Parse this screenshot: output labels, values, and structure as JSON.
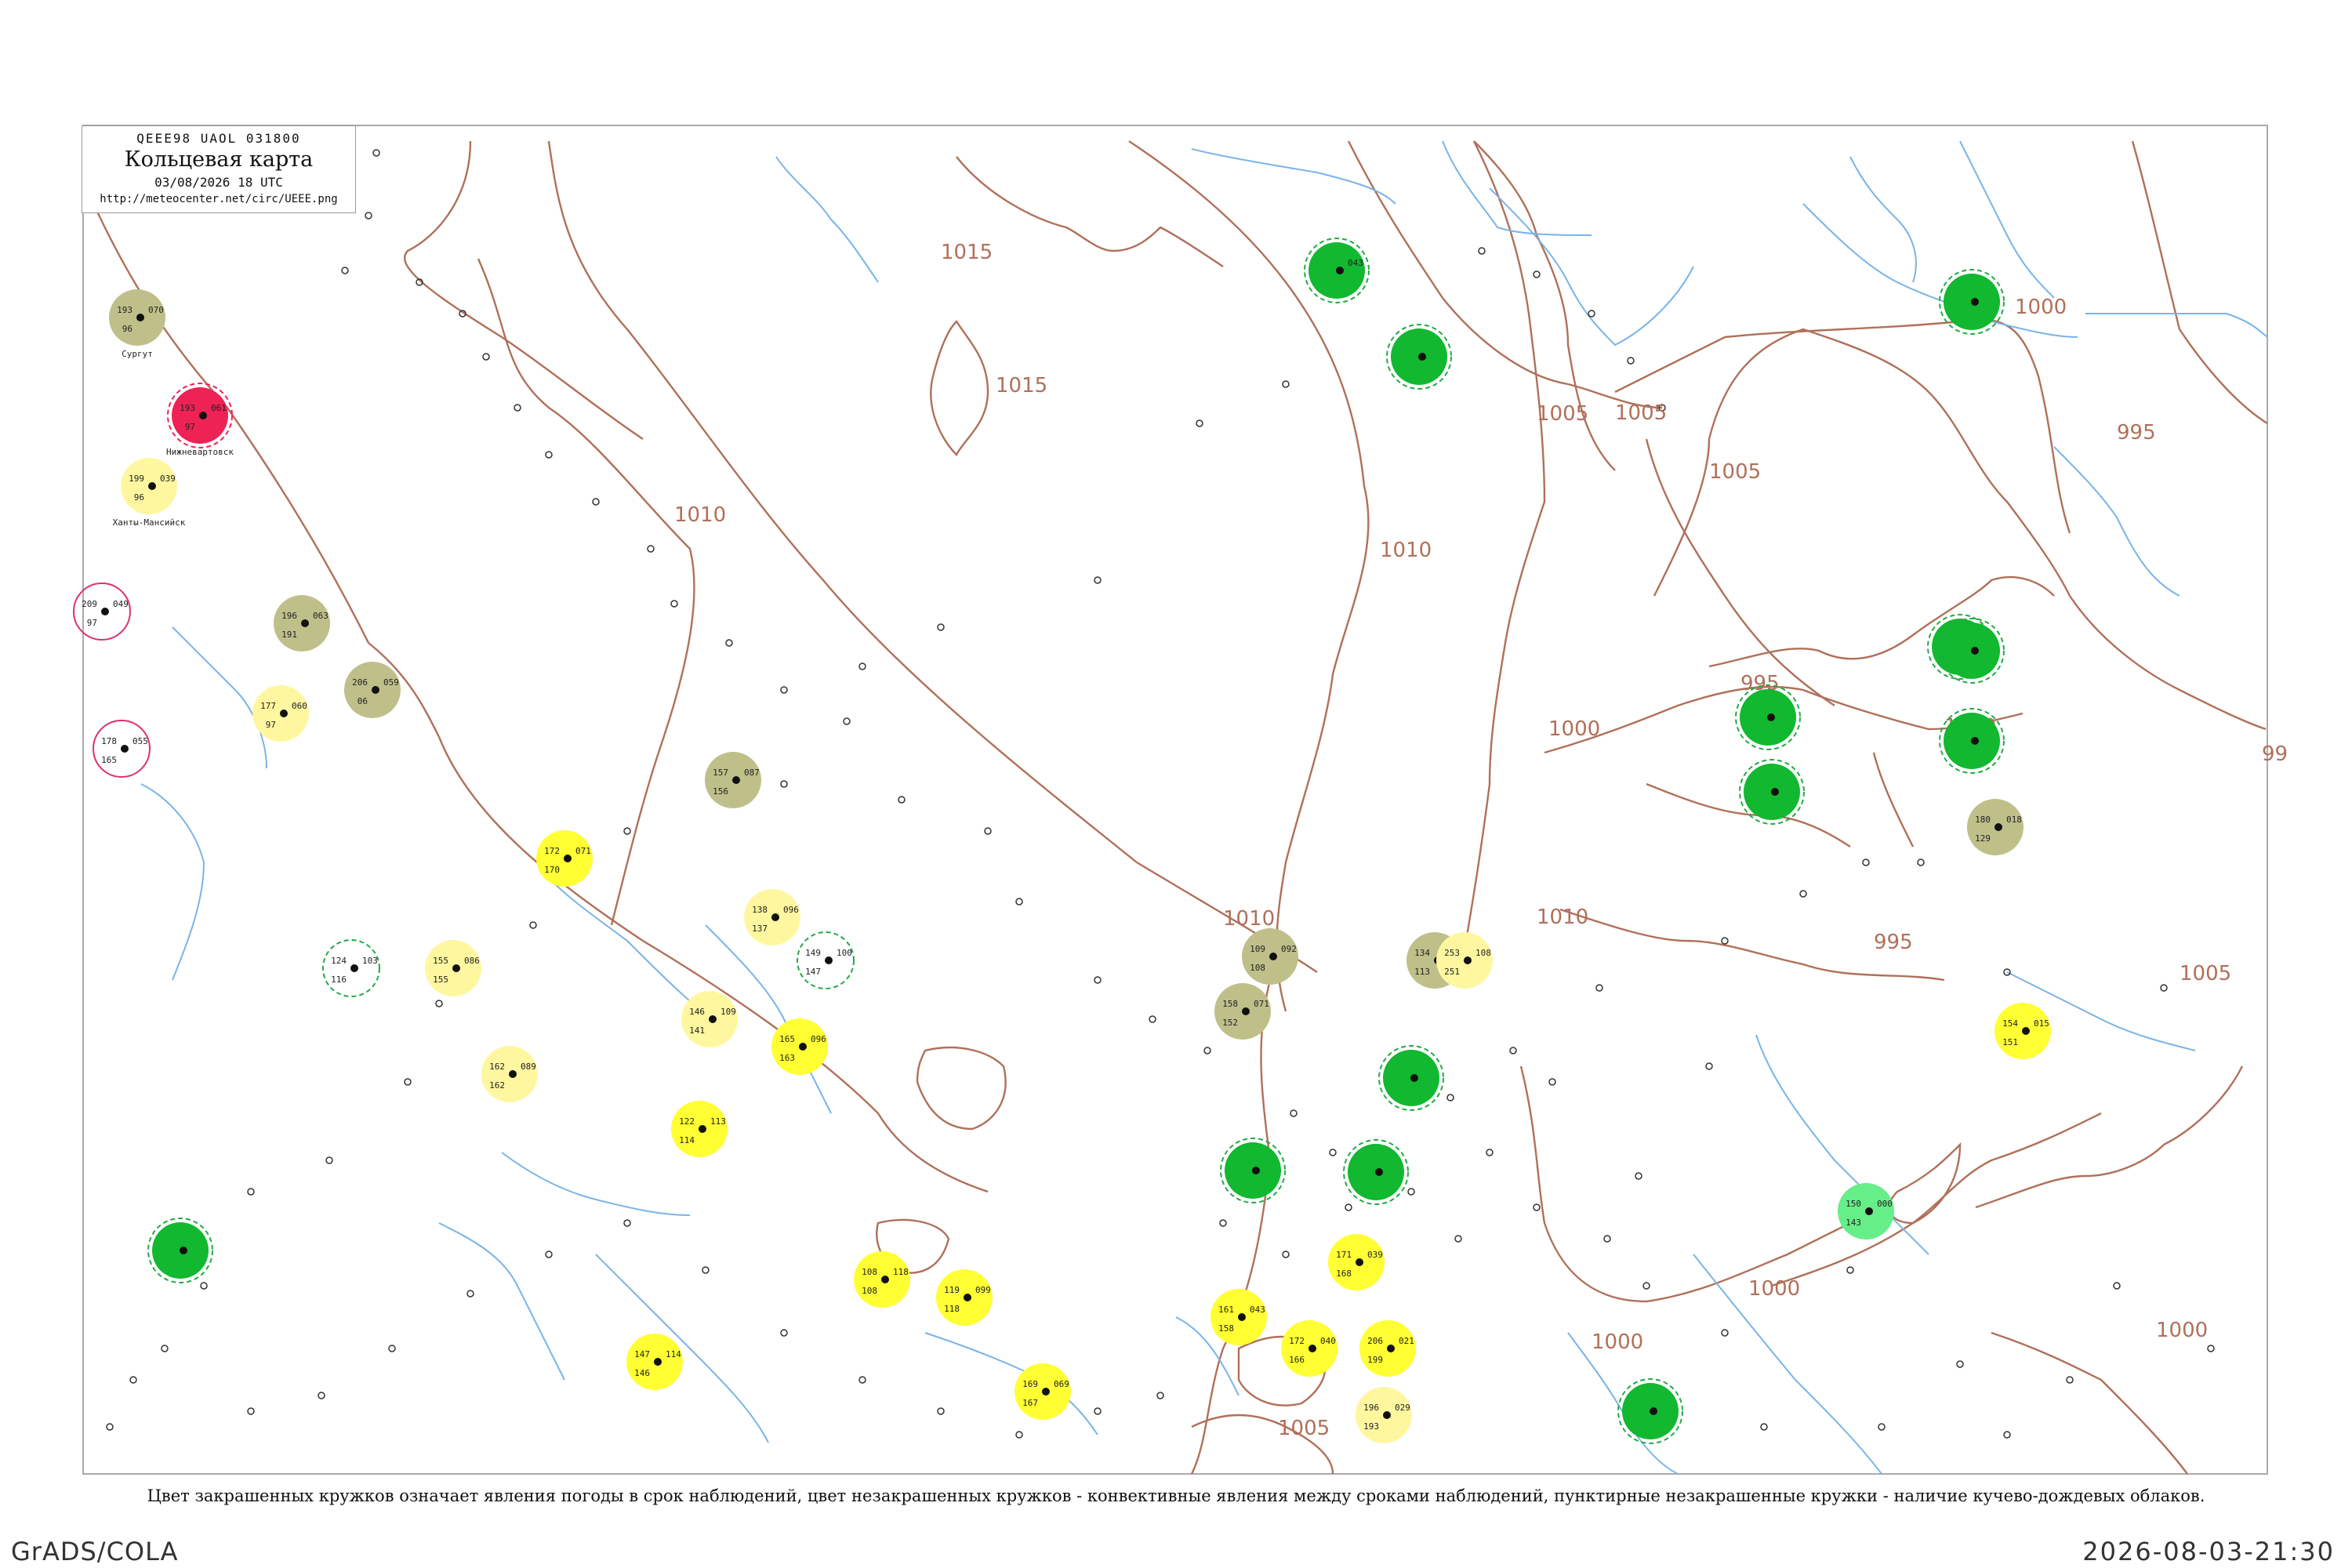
{
  "legend": {
    "header": "QEEE98  UAOL  031800",
    "title": "Кольцевая карта",
    "date": "03/08/2026 18 UTC",
    "url": "http://meteocenter.net/circ/UEEE.png"
  },
  "caption": "Цвет закрашенных кружков означает явления погоды в срок наблюдений, цвет незакрашенных кружков - конвективные явления между сроками наблюдений, пунктирные незакрашенные кружки - наличие кучево-дождевых облаков.",
  "footer": {
    "left": "GrADS/COLA",
    "right": "2026-08-03-21:30"
  },
  "colors": {
    "isobar": "#b0705a",
    "river": "#7ab4e8",
    "frame": "#aaaaaa",
    "thunder": "#11b830",
    "rain": "#ffff33",
    "drizzle": "#fff7a0",
    "fog": "#bfbf8a",
    "hail": "#ee2255",
    "shower": "#66ee88",
    "cb_dashed": "#22aa44",
    "convective_ring": "#dd3366"
  },
  "isobar_labels": [
    {
      "text": "1015"
    },
    {
      "text": "1015"
    },
    {
      "text": "1010"
    },
    {
      "text": "1010"
    },
    {
      "text": "1010"
    },
    {
      "text": "1010"
    },
    {
      "text": "1005"
    },
    {
      "text": "1005"
    },
    {
      "text": "1005"
    },
    {
      "text": "1005"
    },
    {
      "text": "1005"
    },
    {
      "text": "1000"
    },
    {
      "text": "1000"
    },
    {
      "text": "1000"
    },
    {
      "text": "1000"
    },
    {
      "text": "1000"
    },
    {
      "text": "1000"
    },
    {
      "text": "995"
    },
    {
      "text": "995"
    },
    {
      "text": "995"
    },
    {
      "text": "99"
    }
  ],
  "stations": [
    {
      "name": "Сургут",
      "t": "193",
      "td": "96",
      "p": "070",
      "marker": "fog"
    },
    {
      "name": "Нижневартовск",
      "t": "193",
      "td": "97",
      "p": "061",
      "marker": "hail"
    },
    {
      "name": "Ханты-Мансийск",
      "t": "199",
      "td": "96",
      "p": "039",
      "marker": "drizzle"
    },
    {
      "name": "",
      "t": "209",
      "td": "97",
      "p": "049",
      "marker": "ring"
    },
    {
      "name": "",
      "t": "196",
      "td": "191",
      "p": "063",
      "marker": "fog"
    },
    {
      "name": "",
      "t": "206",
      "td": "06",
      "p": "059",
      "marker": "fog"
    },
    {
      "name": "",
      "t": "177",
      "td": "97",
      "p": "060",
      "marker": "drizzle"
    },
    {
      "name": "",
      "t": "178",
      "td": "165",
      "p": "055",
      "marker": "ring"
    },
    {
      "name": "",
      "t": "157",
      "td": "156",
      "p": "087",
      "marker": "fog"
    },
    {
      "name": "",
      "t": "172",
      "td": "170",
      "p": "071",
      "marker": "rain"
    },
    {
      "name": "",
      "t": "138",
      "td": "137",
      "p": "096",
      "marker": "drizzle"
    },
    {
      "name": "",
      "t": "149",
      "td": "147",
      "p": "100",
      "marker": "cb"
    },
    {
      "name": "",
      "t": "124",
      "td": "116",
      "p": "103",
      "marker": "cb"
    },
    {
      "name": "",
      "t": "155",
      "td": "155",
      "p": "086",
      "marker": "drizzle"
    },
    {
      "name": "",
      "t": "146",
      "td": "141",
      "p": "109",
      "marker": "drizzle"
    },
    {
      "name": "",
      "t": "165",
      "td": "163",
      "p": "096",
      "marker": "rain"
    },
    {
      "name": "",
      "t": "162",
      "td": "162",
      "p": "089",
      "marker": "drizzle"
    },
    {
      "name": "",
      "t": "122",
      "td": "114",
      "p": "113",
      "marker": "rain"
    },
    {
      "name": "",
      "t": "108",
      "td": "108",
      "p": "118",
      "marker": "rain"
    },
    {
      "name": "",
      "t": "119",
      "td": "118",
      "p": "099",
      "marker": "rain"
    },
    {
      "name": "",
      "t": "147",
      "td": "146",
      "p": "114",
      "marker": "rain"
    },
    {
      "name": "",
      "t": "169",
      "td": "167",
      "p": "069",
      "marker": "rain"
    },
    {
      "name": "",
      "t": "161",
      "td": "158",
      "p": "043",
      "marker": "rain"
    },
    {
      "name": "",
      "t": "172",
      "td": "166",
      "p": "040",
      "marker": "rain"
    },
    {
      "name": "",
      "t": "171",
      "td": "168",
      "p": "039",
      "marker": "rain"
    },
    {
      "name": "",
      "t": "206",
      "td": "199",
      "p": "021",
      "marker": "rain"
    },
    {
      "name": "",
      "t": "196",
      "td": "193",
      "p": "029",
      "marker": "drizzle"
    },
    {
      "name": "",
      "t": "154",
      "td": "151",
      "p": "015",
      "marker": "rain"
    },
    {
      "name": "",
      "t": "109",
      "td": "108",
      "p": "092",
      "marker": "fog"
    },
    {
      "name": "",
      "t": "158",
      "td": "152",
      "p": "071",
      "marker": "fog"
    },
    {
      "name": "",
      "t": "134",
      "td": "113",
      "p": "046",
      "marker": "fog"
    },
    {
      "name": "",
      "t": "253",
      "td": "251",
      "p": "108",
      "marker": "drizzle"
    },
    {
      "name": "",
      "t": "150",
      "td": "143",
      "p": "000",
      "marker": "shower"
    },
    {
      "name": "",
      "t": "180",
      "td": "129",
      "p": "018",
      "marker": "fog"
    },
    {
      "name": "",
      "t": "",
      "td": "",
      "p": "043",
      "marker": "thunder"
    },
    {
      "name": "",
      "t": "",
      "td": "",
      "p": "",
      "marker": "thunder"
    },
    {
      "name": "",
      "t": "",
      "td": "",
      "p": "",
      "marker": "thunder"
    },
    {
      "name": "",
      "t": "",
      "td": "",
      "p": "",
      "marker": "thunder"
    },
    {
      "name": "",
      "t": "",
      "td": "",
      "p": "",
      "marker": "thunder"
    },
    {
      "name": "",
      "t": "",
      "td": "",
      "p": "",
      "marker": "thunder"
    },
    {
      "name": "",
      "t": "",
      "td": "",
      "p": "",
      "marker": "thunder"
    },
    {
      "name": "",
      "t": "",
      "td": "",
      "p": "",
      "marker": "thunder"
    },
    {
      "name": "",
      "t": "",
      "td": "",
      "p": "",
      "marker": "thunder"
    },
    {
      "name": "",
      "t": "",
      "td": "",
      "p": "",
      "marker": "thunder"
    },
    {
      "name": "",
      "t": "",
      "td": "",
      "p": "",
      "marker": "thunder"
    },
    {
      "name": "",
      "t": "",
      "td": "",
      "p": "",
      "marker": "thunder"
    },
    {
      "name": "",
      "t": "",
      "td": "",
      "p": "",
      "marker": "thunder"
    }
  ]
}
